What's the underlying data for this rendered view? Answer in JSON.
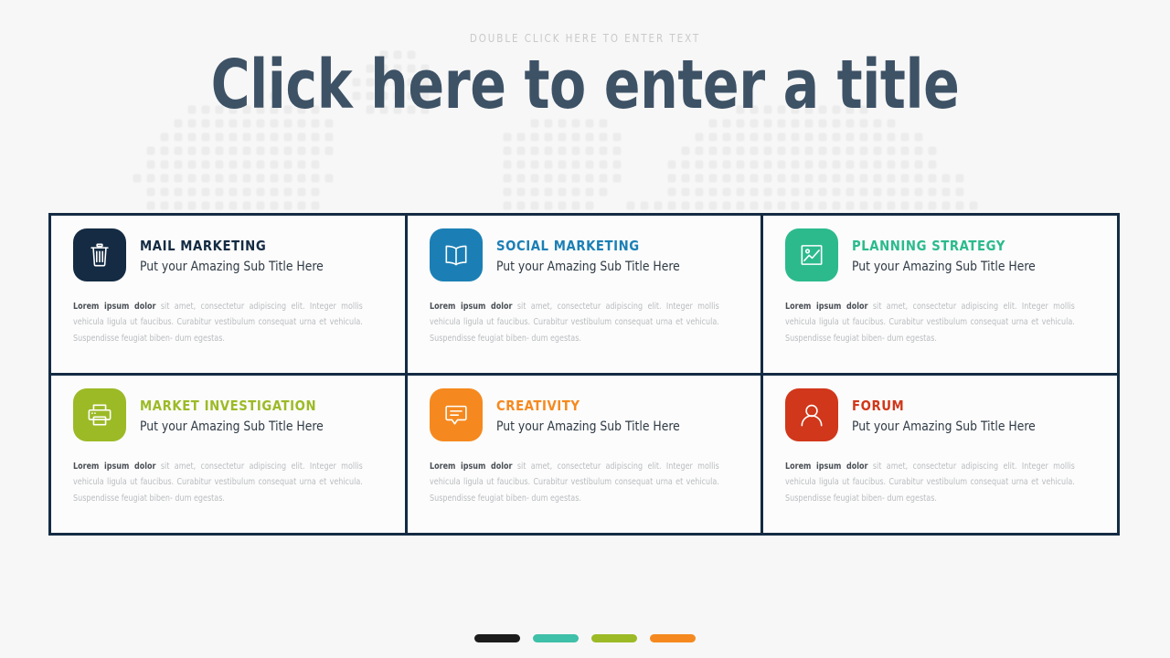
{
  "header": {
    "eyebrow": "DOUBLE CLICK HERE TO ENTER TEXT",
    "title": "Click here to enter a title"
  },
  "theme": {
    "background": "#f7f7f7",
    "map_dot": "#ececec",
    "grid_line": "#142b43",
    "cell_background": "#fcfcfc",
    "title_color": "#3e5266",
    "eyebrow_color": "#c9c9c9",
    "body_text_color": "#b9bcbf",
    "body_strong_color": "#4a4f55",
    "subtitle_color": "#2f3a45"
  },
  "cards": [
    {
      "id": "mail-marketing",
      "icon": "trash-icon",
      "title": "MAIL MARKETING",
      "subtitle": "Put your Amazing Sub Title Here",
      "body_strong": "Lorem ipsum dolor",
      "body": " sit amet, consectetur adipiscing elit. Integer mollis vehicula ligula ut faucibus. Curabitur vestibulum consequat urna et vehicula. Suspendisse feugiat biben- dum egestas.",
      "color": "#142b43",
      "title_color": "#142b43"
    },
    {
      "id": "social-marketing",
      "icon": "book-icon",
      "title": "SOCIAL  MARKETING",
      "subtitle": "Put your Amazing Sub Title Here",
      "body_strong": "Lorem ipsum dolor",
      "body": " sit amet, consectetur adipiscing elit. Integer mollis vehicula ligula ut faucibus. Curabitur vestibulum consequat urna et vehicula. Suspendisse feugiat biben- dum egestas.",
      "color": "#1b7fb5",
      "title_color": "#1b7fb5"
    },
    {
      "id": "planning-strategy",
      "icon": "image-chart-icon",
      "title": "PLANNING  STRATEGY",
      "subtitle": "Put your Amazing Sub Title Here",
      "body_strong": "Lorem ipsum dolor",
      "body": " sit amet, consectetur adipiscing elit. Integer mollis vehicula ligula ut faucibus. Curabitur vestibulum consequat urna et vehicula. Suspendisse feugiat biben- dum egestas.",
      "color": "#2cba8d",
      "title_color": "#2cba8d"
    },
    {
      "id": "market-investigation",
      "icon": "printer-icon",
      "title": "MARKET  INVESTIGATION",
      "subtitle": "Put your Amazing Sub Title Here",
      "body_strong": "Lorem ipsum dolor",
      "body": " sit amet, consectetur adipiscing elit. Integer mollis vehicula ligula ut faucibus. Curabitur vestibulum consequat urna et vehicula. Suspendisse feugiat biben- dum egestas.",
      "color": "#9cba26",
      "title_color": "#9cba26"
    },
    {
      "id": "creativity",
      "icon": "chat-bubble-icon",
      "title": "CREATIVITY",
      "subtitle": "Put your Amazing Sub Title Here",
      "body_strong": "Lorem ipsum dolor",
      "body": " sit amet, consectetur adipiscing elit. Integer mollis vehicula ligula ut faucibus. Curabitur vestibulum consequat urna et vehicula. Suspendisse feugiat biben- dum egestas.",
      "color": "#f5891f",
      "title_color": "#f5891f"
    },
    {
      "id": "forum",
      "icon": "user-icon",
      "title": "FORUM",
      "subtitle": "Put your Amazing Sub Title Here",
      "body_strong": "Lorem ipsum dolor",
      "body": " sit amet, consectetur adipiscing elit. Integer mollis vehicula ligula ut faucibus. Curabitur vestibulum consequat urna et vehicula. Suspendisse feugiat biben- dum egestas.",
      "color": "#d1371a",
      "title_color": "#d1371a"
    }
  ],
  "footer_pills": [
    {
      "name": "pill-1",
      "color": "#1c1c1c"
    },
    {
      "name": "pill-2",
      "color": "#3fc0a8"
    },
    {
      "name": "pill-3",
      "color": "#9cba26"
    },
    {
      "name": "pill-4",
      "color": "#f5891f"
    }
  ]
}
